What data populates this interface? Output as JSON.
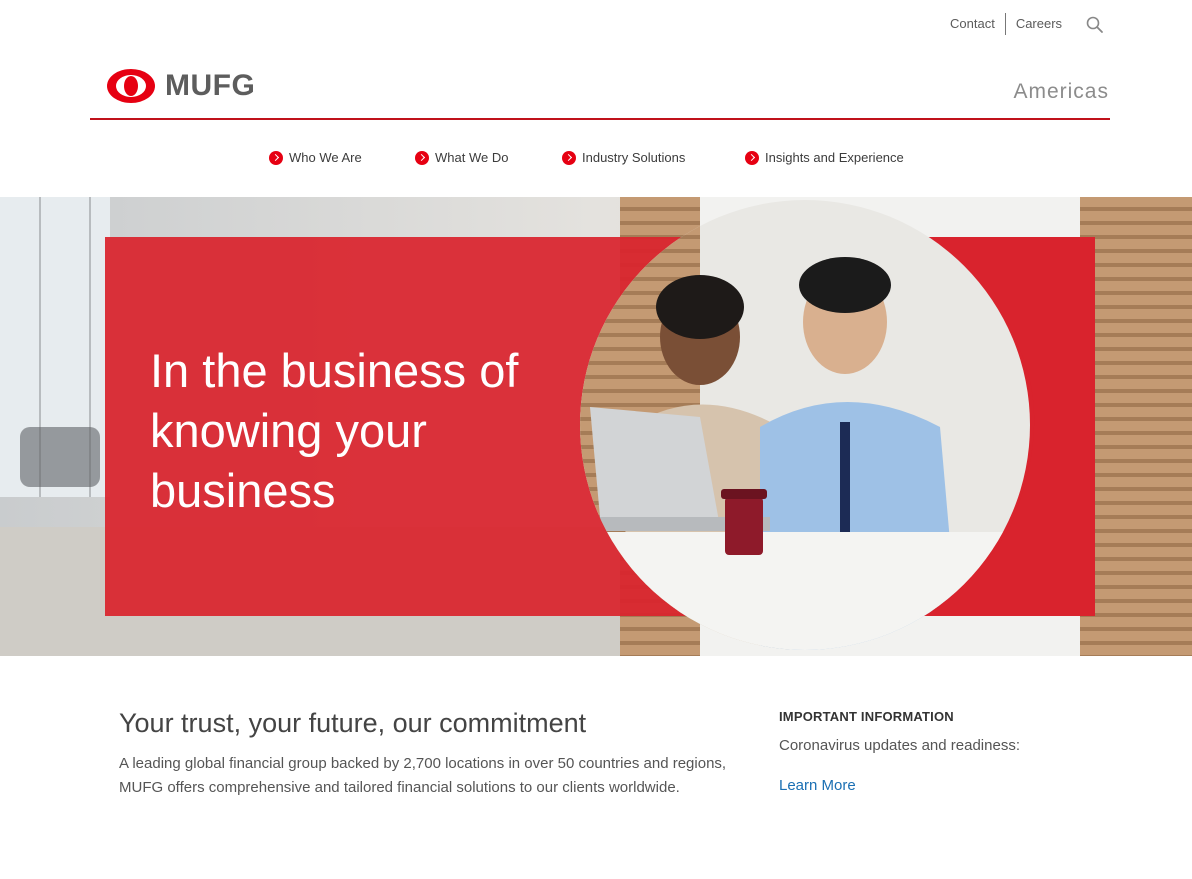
{
  "utility_nav": {
    "contact": "Contact",
    "careers": "Careers"
  },
  "header": {
    "logo_text": "MUFG",
    "region": "Americas"
  },
  "nav": {
    "items": [
      {
        "label": "Who We Are"
      },
      {
        "label": "What We Do"
      },
      {
        "label": "Industry Solutions"
      },
      {
        "label": "Insights and Experience"
      }
    ]
  },
  "hero": {
    "headline_line1": "In the business of",
    "headline_line2": "knowing your",
    "headline_line3": "business"
  },
  "main": {
    "title": "Your trust, your future, our commitment",
    "body": "A leading global financial group backed by 2,700 locations in over 50 countries and regions, MUFG offers comprehensive and tailored financial solutions to our clients worldwide."
  },
  "info": {
    "heading": "IMPORTANT INFORMATION",
    "text": "Coronavirus updates and readiness:",
    "link": "Learn More"
  },
  "colors": {
    "brand_red": "#e60012",
    "hero_red": "#d9232d",
    "link_blue": "#1a6fb3"
  },
  "icons": [
    "search-icon",
    "mufg-logo-icon",
    "chevron-right-icon"
  ]
}
